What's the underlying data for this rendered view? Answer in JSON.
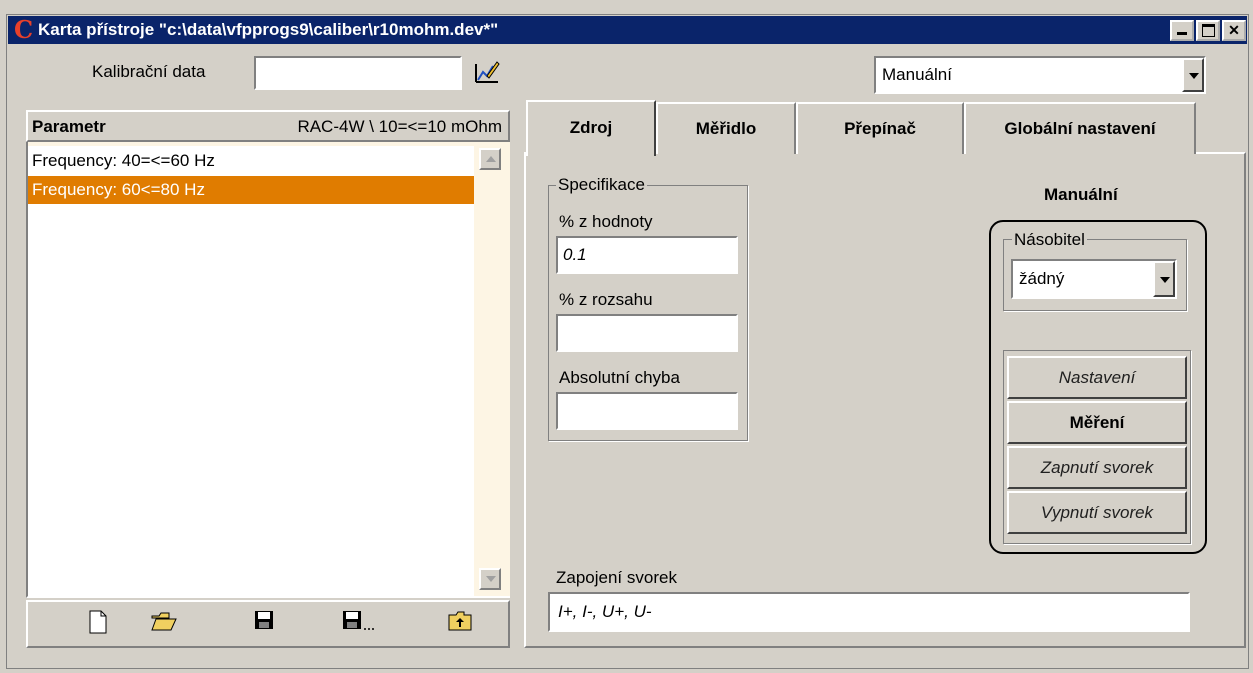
{
  "window": {
    "title": "Karta přístroje \"c:\\data\\vfpprogs9\\caliber\\r10mohm.dev*\""
  },
  "top": {
    "calib_label": "Kalibrační data",
    "calib_value": "",
    "mode_value": "Manuální"
  },
  "list": {
    "header_left": "Parametr",
    "header_right": "RAC-4W \\ 10=<=10 mOhm",
    "items": [
      {
        "label": "Frequency: 40=<=60 Hz"
      },
      {
        "label": "Frequency: 60<=80 Hz"
      }
    ]
  },
  "tabs": [
    "Zdroj",
    "Měřidlo",
    "Přepínač",
    "Globální nastavení"
  ],
  "spec": {
    "caption": "Specifikace",
    "pct_value_label": "% z hodnoty",
    "pct_value": "0.1",
    "pct_range_label": "% z rozsahu",
    "pct_range": "",
    "abs_err_label": "Absolutní chyba",
    "abs_err": ""
  },
  "manual": {
    "title": "Manuální",
    "multiplier_caption": "Násobitel",
    "multiplier_value": "žádný",
    "buttons": [
      "Nastavení",
      "Měření",
      "Zapnutí svorek",
      "Vypnutí svorek"
    ]
  },
  "wiring": {
    "label": "Zapojení svorek",
    "value": "I+, I-, U+, U-"
  },
  "colors": {
    "titlebar": "#0a246a",
    "selected_row": "#e07c00",
    "list_bg": "#fdf5e4"
  }
}
